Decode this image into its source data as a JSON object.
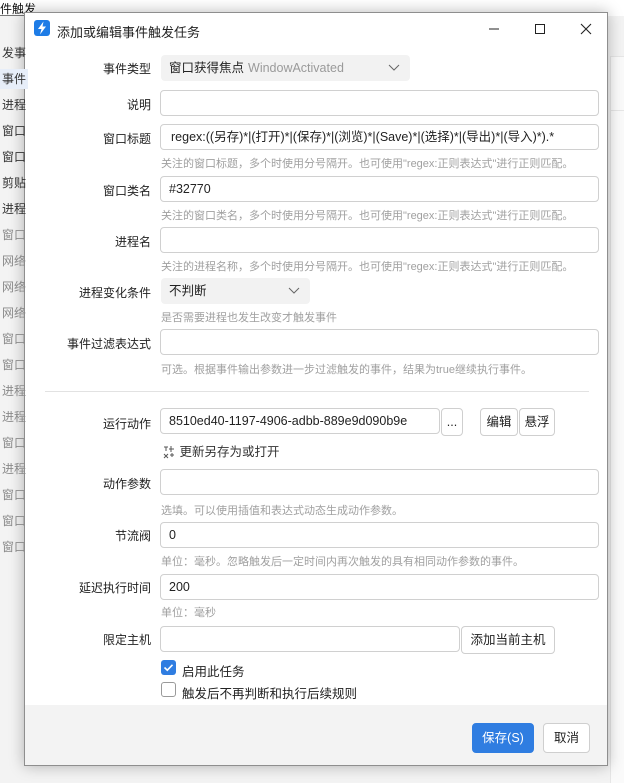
{
  "background": {
    "title": "件触发",
    "list": [
      {
        "label": "发事",
        "dim": false
      },
      {
        "label": "事件",
        "dim": false,
        "selected": true
      },
      {
        "label": "进程",
        "dim": false
      },
      {
        "label": "窗口",
        "dim": false
      },
      {
        "label": "窗口",
        "dim": false
      },
      {
        "label": "剪贴",
        "dim": false
      },
      {
        "label": "进程",
        "dim": false
      },
      {
        "label": "窗口",
        "dim": true
      },
      {
        "label": "网络",
        "dim": true
      },
      {
        "label": "网络",
        "dim": true
      },
      {
        "label": "网络",
        "dim": true
      },
      {
        "label": "窗口",
        "dim": true
      },
      {
        "label": "窗口",
        "dim": true
      },
      {
        "label": "进程",
        "dim": true
      },
      {
        "label": "进程",
        "dim": true
      },
      {
        "label": "窗口",
        "dim": true
      },
      {
        "label": "进程",
        "dim": true
      },
      {
        "label": "窗口",
        "dim": true
      },
      {
        "label": "窗口",
        "dim": true
      },
      {
        "label": "窗口",
        "dim": true
      }
    ]
  },
  "dialog": {
    "title": "添加或编辑事件触发任务",
    "event_type": {
      "label": "事件类型",
      "value": "窗口获得焦点",
      "value_en": "WindowActivated"
    },
    "description": {
      "label": "说明",
      "value": ""
    },
    "window_title": {
      "label": "窗口标题",
      "value": "regex:((另存)*|(打开)*|(保存)*|(浏览)*|(Save)*|(选择)*|(导出)*|(导入)*).*",
      "hint": "关注的窗口标题，多个时使用分号隔开。也可使用\"regex:正则表达式\"进行正则匹配。"
    },
    "window_class": {
      "label": "窗口类名",
      "value": "#32770",
      "hint": "关注的窗口类名，多个时使用分号隔开。也可使用\"regex:正则表达式\"进行正则匹配。"
    },
    "process_name": {
      "label": "进程名",
      "value": "",
      "hint": "关注的进程名称，多个时使用分号隔开。也可使用\"regex:正则表达式\"进行正则匹配。"
    },
    "process_change": {
      "label": "进程变化条件",
      "value": "不判断",
      "hint": "是否需要进程也发生改变才触发事件"
    },
    "filter_expr": {
      "label": "事件过滤表达式",
      "value": "",
      "hint": "可选。根据事件输出参数进一步过滤触发的事件，结果为true继续执行事件。"
    },
    "run_action": {
      "label": "运行动作",
      "value": "8510ed40-1197-4906-adbb-889e9d090b9e",
      "more_label": "...",
      "edit_label": "编辑",
      "float_label": "悬浮",
      "link_text": "更新另存为或打开"
    },
    "action_params": {
      "label": "动作参数",
      "value": "",
      "hint": "选填。可以使用插值和表达式动态生成动作参数。"
    },
    "throttle": {
      "label": "节流阀",
      "value": "0",
      "hint": "单位：毫秒。忽略触发后一定时间内再次触发的具有相同动作参数的事件。"
    },
    "delay": {
      "label": "延迟执行时间",
      "value": "200",
      "hint": "单位：毫秒"
    },
    "host": {
      "label": "限定主机",
      "value": "",
      "add_label": "添加当前主机"
    },
    "enable_task": {
      "label": "启用此任务",
      "checked": true
    },
    "stop_after": {
      "label": "触发后不再判断和执行后续规则",
      "checked": false
    },
    "save_label": "保存(S)",
    "cancel_label": "取消"
  },
  "colors": {
    "accent": "#2f7de1",
    "hint": "#a0a0a0"
  }
}
